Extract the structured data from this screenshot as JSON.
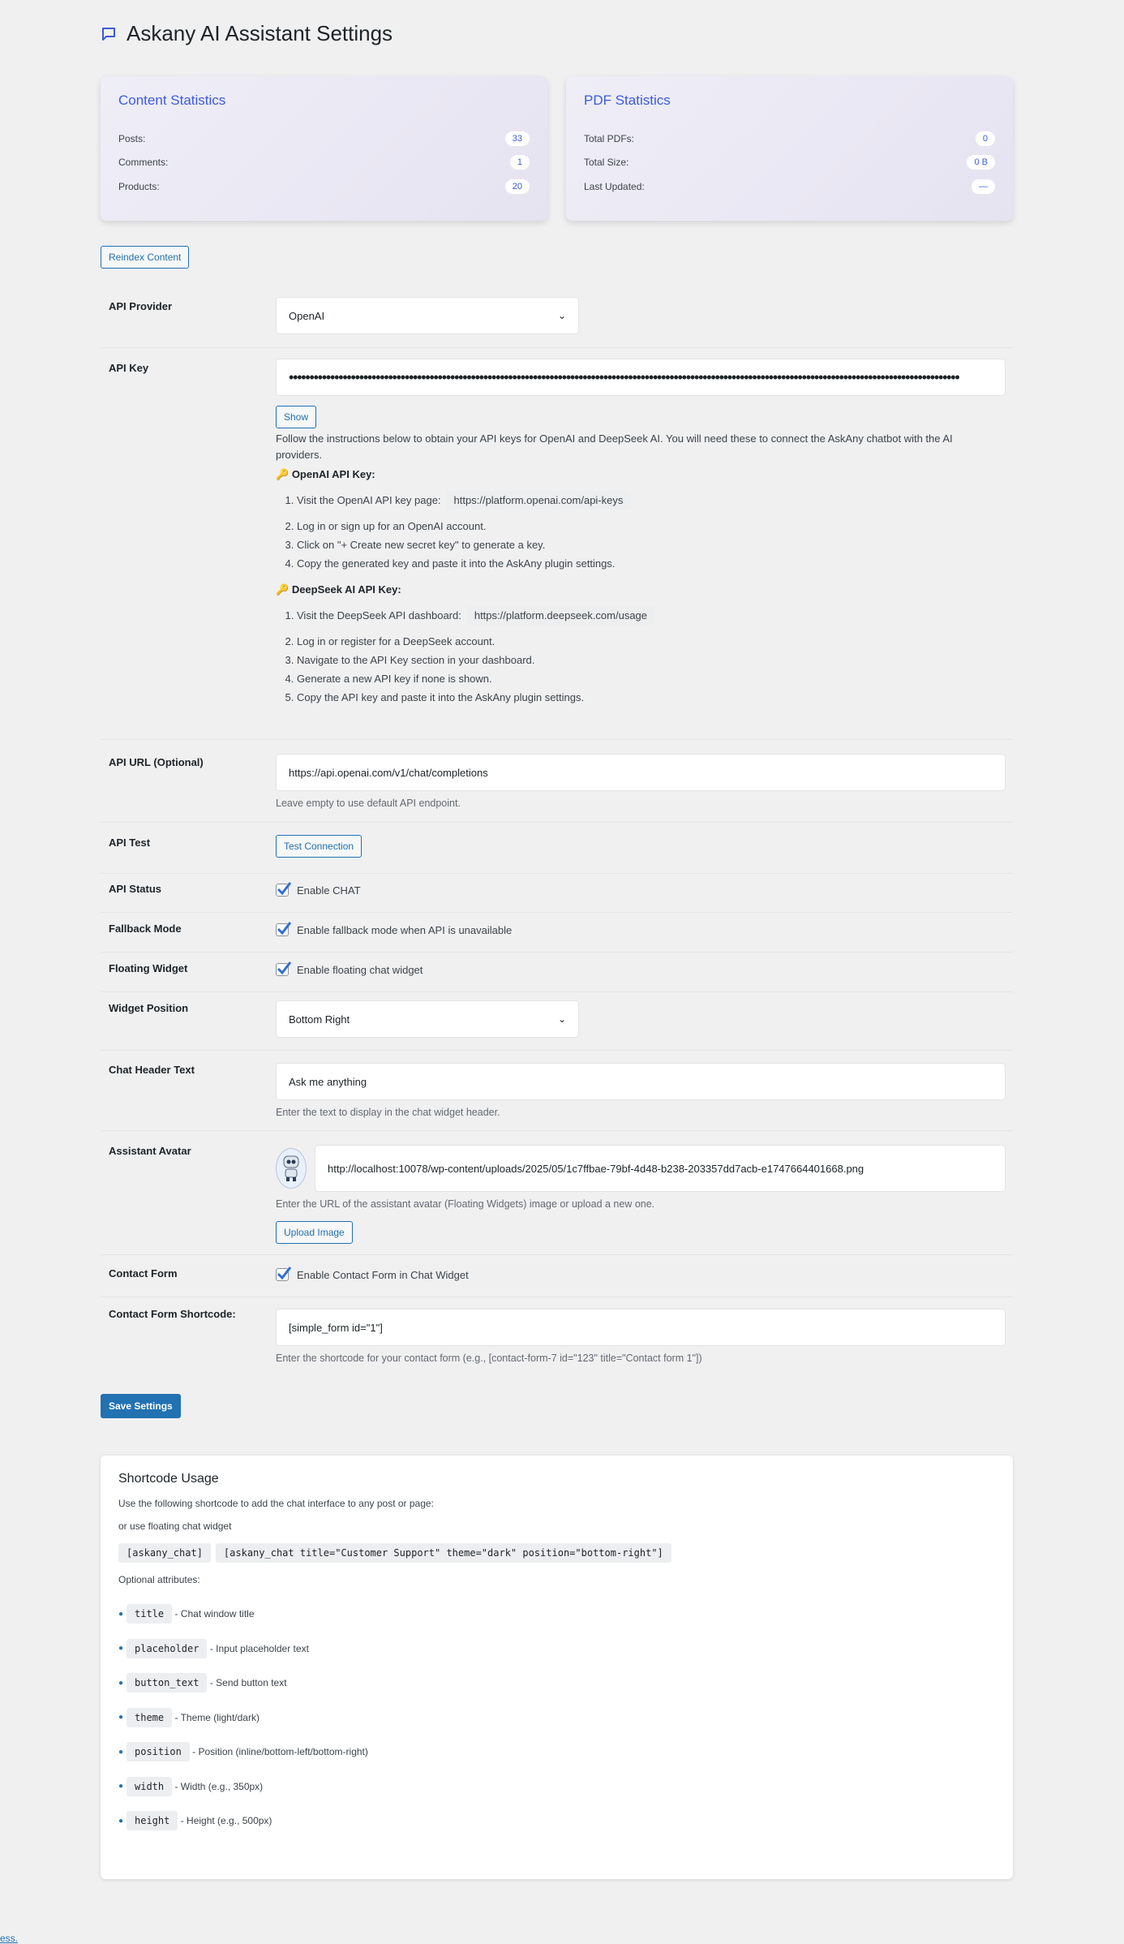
{
  "page": {
    "title": "Askany AI Assistant Settings",
    "title_icon": "chat-bubble-icon"
  },
  "content_stats": {
    "heading": "Content Statistics",
    "rows": [
      {
        "label": "Posts:",
        "value": "33"
      },
      {
        "label": "Comments:",
        "value": "1"
      },
      {
        "label": "Products:",
        "value": "20"
      }
    ]
  },
  "pdf_stats": {
    "heading": "PDF Statistics",
    "rows": [
      {
        "label": "Total PDFs:",
        "value": "0"
      },
      {
        "label": "Total Size:",
        "value": "0 B"
      },
      {
        "label": "Last Updated:",
        "value": "—"
      }
    ]
  },
  "reindex_label": "Reindex Content",
  "api_provider": {
    "label": "API Provider",
    "value": "OpenAI"
  },
  "api_key": {
    "label": "API Key",
    "masked": "••••••••••••••••••••••••••••••••••••••••••••••••••••••••••••••••••••••••••••••••••••••••••••••••••••••••••••••••••••••••••••••••••••••••••••••••••••••••••••••••••",
    "show_label": "Show",
    "intro": "Follow the instructions below to obtain your API keys for OpenAI and DeepSeek AI. You will need these to connect the AskAny chatbot with the AI providers.",
    "openai_heading": "OpenAI API Key:",
    "openai_step1": "Visit the OpenAI API key page:",
    "openai_url": "https://platform.openai.com/api-keys",
    "openai_steps": [
      "Log in or sign up for an OpenAI account.",
      "Click on \"+ Create new secret key\" to generate a key.",
      "Copy the generated key and paste it into the AskAny plugin settings."
    ],
    "deepseek_heading": "DeepSeek AI API Key:",
    "deepseek_step1": "Visit the DeepSeek API dashboard:",
    "deepseek_url": "https://platform.deepseek.com/usage",
    "deepseek_steps": [
      "Log in or register for a DeepSeek account.",
      "Navigate to the API Key section in your dashboard.",
      "Generate a new API key if none is shown.",
      "Copy the API key and paste it into the AskAny plugin settings."
    ]
  },
  "api_url": {
    "label": "API URL (Optional)",
    "value": "https://api.openai.com/v1/chat/completions",
    "desc": "Leave empty to use default API endpoint."
  },
  "api_test": {
    "label": "API Test",
    "button": "Test Connection"
  },
  "api_status": {
    "label": "API Status",
    "check": "Enable CHAT"
  },
  "fallback": {
    "label": "Fallback Mode",
    "check": "Enable fallback mode when API is unavailable"
  },
  "floating": {
    "label": "Floating Widget",
    "check": "Enable floating chat widget"
  },
  "widget_position": {
    "label": "Widget Position",
    "value": "Bottom Right"
  },
  "header_text": {
    "label": "Chat Header Text",
    "value": "Ask me anything",
    "desc": "Enter the text to display in the chat widget header."
  },
  "avatar": {
    "label": "Assistant Avatar",
    "value": "http://localhost:10078/wp-content/uploads/2025/05/1c7ffbae-79bf-4d48-b238-203357dd7acb-e1747664401668.png",
    "desc": "Enter the URL of the assistant avatar (Floating Widgets) image or upload a new one.",
    "upload": "Upload Image"
  },
  "contact_form": {
    "label": "Contact Form",
    "check": "Enable Contact Form in Chat Widget"
  },
  "contact_shortcode": {
    "label": "Contact Form Shortcode:",
    "value": "[simple_form id=\"1\"]",
    "desc": "Enter the shortcode for your contact form (e.g., [contact-form-7 id=\"123\" title=\"Contact form 1\"])"
  },
  "save_label": "Save Settings",
  "shortcode_usage": {
    "heading": "Shortcode Usage",
    "line1": "Use the following shortcode to add the chat interface to any post or page:",
    "line2": "or use floating chat widget",
    "code1": "[askany_chat]",
    "code2": "[askany_chat title=\"Customer Support\" theme=\"dark\" position=\"bottom-right\"]",
    "optional": "Optional attributes:",
    "attrs": [
      {
        "name": "title",
        "desc": "- Chat window title"
      },
      {
        "name": "placeholder",
        "desc": "- Input placeholder text"
      },
      {
        "name": "button_text",
        "desc": "- Send button text"
      },
      {
        "name": "theme",
        "desc": "- Theme (light/dark)"
      },
      {
        "name": "position",
        "desc": "- Position (inline/bottom-left/bottom-right)"
      },
      {
        "name": "width",
        "desc": "- Width (e.g., 350px)"
      },
      {
        "name": "height",
        "desc": "- Height (e.g., 500px)"
      }
    ]
  },
  "footer_link": "ess."
}
